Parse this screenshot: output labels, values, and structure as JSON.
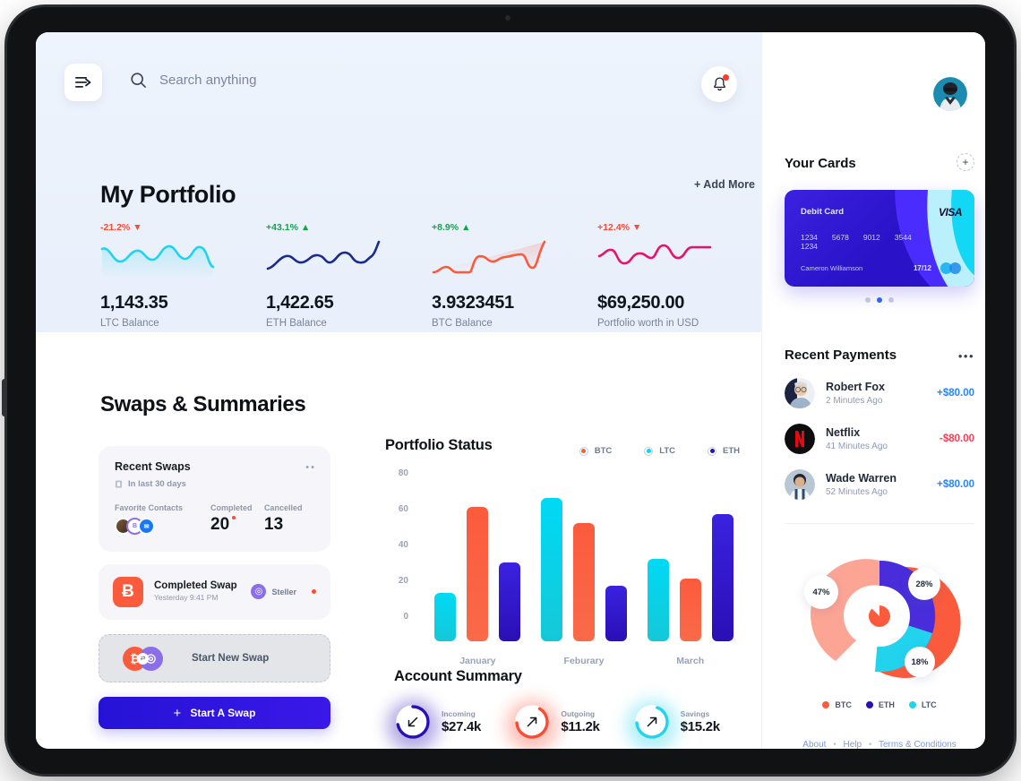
{
  "header": {
    "menu_icon": "menu-arrow-icon",
    "search_icon": "search-icon",
    "search_value": "",
    "search_placeholder": "Search anything",
    "bell_icon": "bell-icon",
    "avatar": "user-avatar"
  },
  "portfolio": {
    "title": "My Portfolio",
    "add_more": "+ Add More",
    "stats": [
      {
        "pct": "-21.2%",
        "dir": "down",
        "value": "1,143.35",
        "label": "LTC Balance",
        "color": "#22d3ee"
      },
      {
        "pct": "+43.1%",
        "dir": "up",
        "value": "1,422.65",
        "label": "ETH Balance",
        "color": "#1a2b8f"
      },
      {
        "pct": "+8.9%",
        "dir": "up",
        "value": "3.9323451",
        "label": "BTC Balance",
        "color": "#fb5b3d"
      },
      {
        "pct": "+12.4%",
        "dir": "down",
        "value": "$69,250.00",
        "label": "Portfolio worth in USD",
        "color": "#e8136b"
      }
    ]
  },
  "swaps": {
    "title": "Swaps & Summaries",
    "recent": {
      "title": "Recent Swaps",
      "subtitle": "In last 30 days",
      "calendar_icon": "calendar-icon",
      "more_icon": "more-dots-icon",
      "contacts_label": "Favorite Contacts",
      "completed_label": "Completed",
      "completed_value": "20",
      "cancelled_label": "Cancelled",
      "cancelled_value": "13"
    },
    "completed_swap": {
      "icon": "bitcoin-icon",
      "symbol": "Ƀ",
      "title": "Completed Swap",
      "time": "Yesterday 9:41 PM",
      "provider": "Steller",
      "provider_icon": "steller-icon"
    },
    "start_new": {
      "label": "Start New Swap",
      "from_icon": "bitcoin-icon",
      "to_icon": "steller-icon",
      "swap_icon": "swap-arrows-icon"
    },
    "start_button": {
      "label": "Start A Swap",
      "icon": "plus-icon"
    }
  },
  "chart_data": {
    "type": "bar",
    "title": "Portfolio Status",
    "categories": [
      "January",
      "Feburary",
      "March"
    ],
    "series": [
      {
        "name": "LTC",
        "color": "#00d9f5",
        "values": [
          27,
          80,
          46
        ]
      },
      {
        "name": "BTC",
        "color": "#fb5b3d",
        "values": [
          75,
          66,
          35
        ]
      },
      {
        "name": "ETH",
        "color": "#2a0fb5",
        "values": [
          44,
          31,
          71
        ]
      }
    ],
    "legend": [
      "BTC",
      "LTC",
      "ETH"
    ],
    "legend_position": "top-right",
    "yticks": [
      80,
      60,
      40,
      20,
      0
    ],
    "ylim": [
      0,
      80
    ],
    "xlabel": "",
    "ylabel": "",
    "grid": false
  },
  "donut_data": {
    "type": "pie",
    "title": "",
    "labels": [
      "BTC",
      "ETH",
      "LTC"
    ],
    "values": [
      47,
      28,
      18
    ],
    "display": [
      "47%",
      "28%",
      "18%"
    ],
    "colors": [
      "#fb5b3d",
      "#2a0fb5",
      "#22d3ee"
    ],
    "legend_position": "bottom"
  },
  "account_summary": {
    "title": "Account Summary",
    "items": [
      {
        "label": "Incoming",
        "value": "$27.4k",
        "color": "#2a0fb5",
        "icon": "arrow-down-left-icon",
        "pct": 72
      },
      {
        "label": "Outgoing",
        "value": "$11.2k",
        "color": "#fb4b33",
        "icon": "arrow-up-right-icon",
        "pct": 66
      },
      {
        "label": "Savings",
        "value": "$15.2k",
        "color": "#22d3ee",
        "icon": "arrow-up-right-icon",
        "pct": 68
      }
    ]
  },
  "sidebar": {
    "cards": {
      "title": "Your Cards",
      "add_icon": "plus-circle-icon",
      "card": {
        "label": "Debit Card",
        "brand": "VISA",
        "numbers": [
          "1234",
          "5678",
          "9012",
          "3544",
          "1234"
        ],
        "holder": "Cameron Williamson",
        "expiry": "17/12",
        "chip_icon": "mastercard-icon"
      },
      "dots": [
        false,
        true,
        false
      ]
    },
    "payments": {
      "title": "Recent Payments",
      "more_icon": "more-dots-icon",
      "items": [
        {
          "name": "Robert Fox",
          "time": "2 Minutes Ago",
          "amount": "+$80.00",
          "sign": "pos",
          "avatar": "avatar-robert-fox"
        },
        {
          "name": "Netflix",
          "time": "41 Minutes Ago",
          "amount": "-$80.00",
          "sign": "neg",
          "avatar": "netflix-icon"
        },
        {
          "name": "Wade Warren",
          "time": "52 Minutes Ago",
          "amount": "+$80.00",
          "sign": "pos",
          "avatar": "avatar-wade-warren"
        }
      ]
    },
    "footer": {
      "about": "About",
      "help": "Help",
      "terms": "Terms & Conditions",
      "separator": "•"
    }
  }
}
